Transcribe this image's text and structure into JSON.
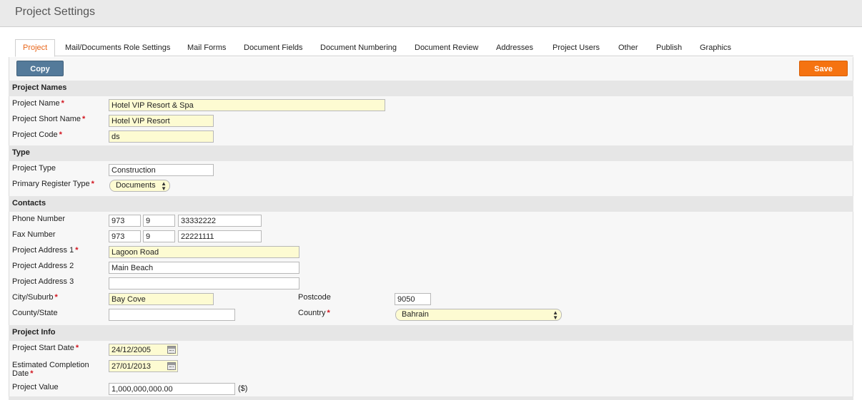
{
  "page": {
    "title": "Project Settings"
  },
  "tabs": [
    {
      "label": "Project",
      "active": true
    },
    {
      "label": "Mail/Documents Role Settings"
    },
    {
      "label": "Mail Forms"
    },
    {
      "label": "Document Fields"
    },
    {
      "label": "Document Numbering"
    },
    {
      "label": "Document Review"
    },
    {
      "label": "Addresses"
    },
    {
      "label": "Project Users"
    },
    {
      "label": "Other"
    },
    {
      "label": "Publish"
    },
    {
      "label": "Graphics"
    }
  ],
  "toolbar": {
    "copy_label": "Copy",
    "save_label": "Save"
  },
  "required_marker": "*",
  "sections": {
    "names": "Project Names",
    "type": "Type",
    "contacts": "Contacts",
    "info": "Project Info"
  },
  "fields": {
    "project_name": {
      "label": "Project Name",
      "value": "Hotel VIP Resort & Spa"
    },
    "short_name": {
      "label": "Project Short Name",
      "value": "Hotel VIP Resort"
    },
    "code": {
      "label": "Project Code",
      "value": "ds"
    },
    "project_type": {
      "label": "Project Type",
      "value": "Construction"
    },
    "register_type": {
      "label": "Primary Register Type",
      "value": "Documents"
    },
    "phone": {
      "label": "Phone Number",
      "country": "973",
      "area": "9",
      "number": "33332222"
    },
    "fax": {
      "label": "Fax Number",
      "country": "973",
      "area": "9",
      "number": "22221111"
    },
    "address1": {
      "label": "Project Address 1",
      "value": "Lagoon Road"
    },
    "address2": {
      "label": "Project Address 2",
      "value": "Main Beach"
    },
    "address3": {
      "label": "Project Address 3",
      "value": ""
    },
    "city": {
      "label": "City/Suburb",
      "value": "Bay Cove"
    },
    "postcode": {
      "label": "Postcode",
      "value": "9050"
    },
    "county": {
      "label": "County/State",
      "value": ""
    },
    "country": {
      "label": "Country",
      "value": "Bahrain"
    },
    "start_date": {
      "label": "Project Start Date",
      "value": "24/12/2005"
    },
    "completion_date": {
      "label": "Estimated Completion Date",
      "value": "27/01/2013"
    },
    "project_value": {
      "label": "Project Value",
      "value": "1,000,000,000.00",
      "unit": "($)"
    }
  }
}
